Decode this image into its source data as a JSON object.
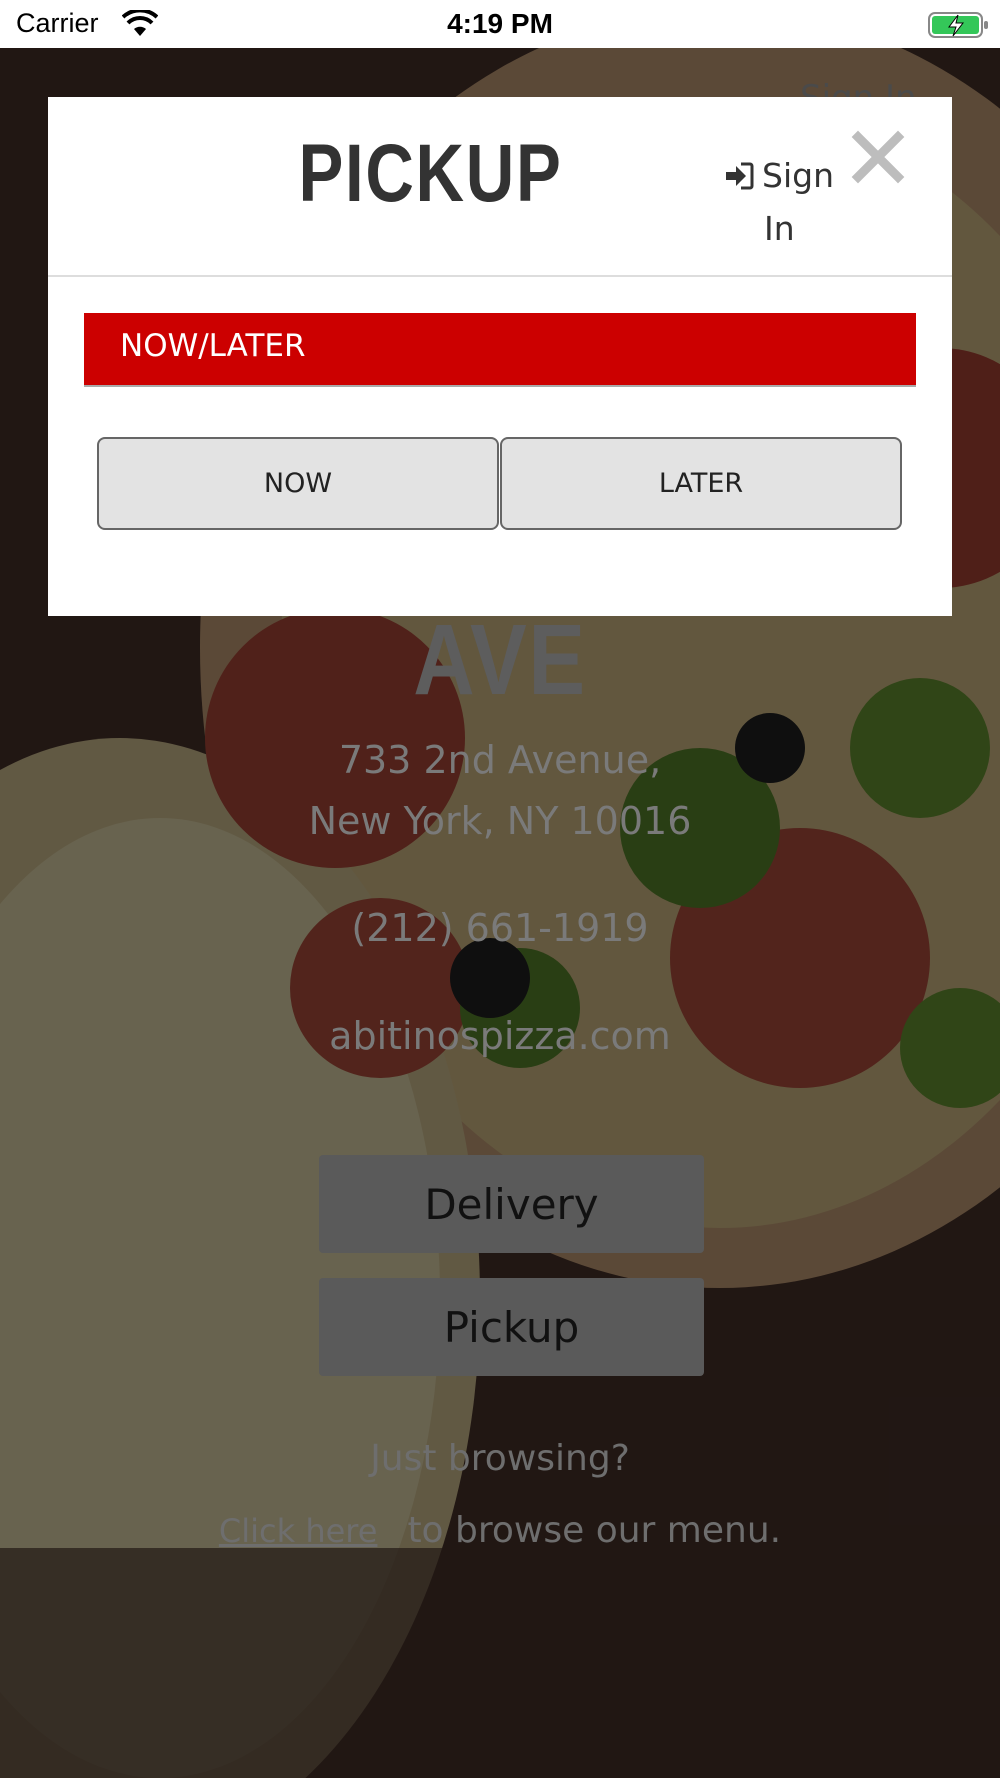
{
  "status_bar": {
    "carrier": "Carrier",
    "time": "4:19 PM",
    "icons": [
      "wifi-icon",
      "battery-charging-icon"
    ]
  },
  "background": {
    "signin_label": "Sign In",
    "store_name_partial": "AVE",
    "address_line1": "733 2nd Avenue,",
    "address_line2": "New York, NY 10016",
    "phone": "(212) 661-1919",
    "website": "abitinospizza.com",
    "delivery_button": "Delivery",
    "pickup_button": "Pickup",
    "browse_question": "Just browsing?",
    "click_here_link": "Click here",
    "browse_suffix": "to browse our menu."
  },
  "modal": {
    "title": "PICKUP",
    "signin_line1": "Sign",
    "signin_line2": "In",
    "section_label": "NOW/LATER",
    "now_button": "NOW",
    "later_button": "LATER",
    "colors": {
      "section_bar": "#cc0000",
      "choice_bg": "#e3e3e3"
    }
  }
}
